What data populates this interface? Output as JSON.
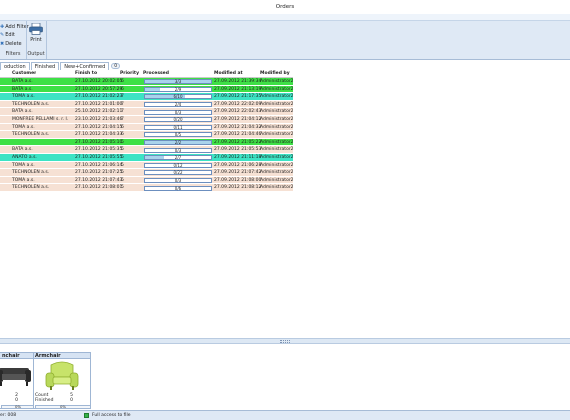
{
  "window": {
    "title": "Orders"
  },
  "ribbon": {
    "add_filter": "Add Filter",
    "edit": "Edit",
    "delete": "Delete",
    "filters_label": "Filters",
    "print": "Print",
    "output_label": "Output"
  },
  "tabs": [
    {
      "label": "oduction"
    },
    {
      "label": "Finished"
    },
    {
      "label": "New+Confirmed"
    }
  ],
  "tab_badge": "0",
  "grid": {
    "columns": [
      "Customer",
      "Finish to",
      "Priority",
      "Processed",
      "Modified at",
      "Modified by"
    ],
    "rows": [
      {
        "customer": "BATA a.s.",
        "finish": "27.10.2012 20:02:05",
        "priority": "6",
        "processed": "3/3",
        "progress": 1.0,
        "modified_at": "27.09.2012 21:39:34",
        "modified_by": "Administrator2",
        "bg": "#3ee046"
      },
      {
        "customer": "BATA a.s.",
        "finish": "27.10.2012 20:57:29",
        "priority": "6",
        "processed": "2/9",
        "progress": 0.22,
        "modified_at": "27.09.2012 21:13:19",
        "modified_by": "Administrator2",
        "bg": "#3ee046"
      },
      {
        "customer": "TOMA a.s.",
        "finish": "27.10.2012 21:02:23",
        "priority": "7",
        "processed": "6/10",
        "progress": 0.6,
        "modified_at": "27.09.2012 21:17:35",
        "modified_by": "Administrator2",
        "bg": "#3de3c4"
      },
      {
        "customer": "TECHNOLEN a.s.",
        "finish": "27.10.2012 21:01:00",
        "priority": "7",
        "processed": "2/4",
        "progress": 0,
        "modified_at": "27.09.2012 22:02:09",
        "modified_by": "Administrator2",
        "bg": "#f6e1d4"
      },
      {
        "customer": "BATA a.s.",
        "finish": "25.10.2012 21:02:11",
        "priority": "7",
        "processed": "0/3",
        "progress": 0,
        "modified_at": "27.09.2012 22:02:43",
        "modified_by": "Administrator2",
        "bg": "#f6e1d4"
      },
      {
        "customer": "MONFREE PELLAMI s. r. l.",
        "finish": "23.10.2012 21:03:46",
        "priority": "7",
        "processed": "0/20",
        "progress": 0,
        "modified_at": "27.09.2012 21:04:12",
        "modified_by": "Administrator2",
        "bg": "#f6e1d4"
      },
      {
        "customer": "TOMA a.s.",
        "finish": "27.10.2012 21:04:15",
        "priority": "6",
        "processed": "0/11",
        "progress": 0,
        "modified_at": "27.09.2012 21:04:32",
        "modified_by": "Administrator2",
        "bg": "#f6e1d4"
      },
      {
        "customer": "TECHNOLEN a.s.",
        "finish": "27.10.2012 21:04:33",
        "priority": "6",
        "processed": "0/5",
        "progress": 0,
        "modified_at": "27.09.2012 21:04:46",
        "modified_by": "Administrator2",
        "bg": "#f6e1d4"
      },
      {
        "customer": "",
        "finish": "27.10.2012 21:05:10",
        "priority": "5",
        "processed": "2/2",
        "progress": 1.0,
        "modified_at": "27.09.2012 21:05:22",
        "modified_by": "Administrator2",
        "bg": "#3ee046"
      },
      {
        "customer": "BATA a.s.",
        "finish": "27.10.2012 21:05:35",
        "priority": "5",
        "processed": "0/3",
        "progress": 0,
        "modified_at": "27.09.2012 21:05:53",
        "modified_by": "Administrator2",
        "bg": "#f6e1d4"
      },
      {
        "customer": "ANATO a.s.",
        "finish": "27.10.2012 21:05:55",
        "priority": "5",
        "processed": "2/7",
        "progress": 0.29,
        "modified_at": "27.09.2012 21:11:18",
        "modified_by": "Administrator2",
        "bg": "#3de3c4"
      },
      {
        "customer": "TOMA a.s.",
        "finish": "27.10.2012 21:06:14",
        "priority": "5",
        "processed": "0/12",
        "progress": 0,
        "modified_at": "27.09.2012 21:06:28",
        "modified_by": "Administrator2",
        "bg": "#f6e1d4"
      },
      {
        "customer": "TECHNOLEN a.s.",
        "finish": "27.10.2012 21:07:25",
        "priority": "5",
        "processed": "0/22",
        "progress": 0,
        "modified_at": "27.09.2012 21:07:42",
        "modified_by": "Administrator2",
        "bg": "#f6e1d4"
      },
      {
        "customer": "TOMA a.s.",
        "finish": "27.10.2012 21:07:43",
        "priority": "5",
        "processed": "0/3",
        "progress": 0,
        "modified_at": "27.09.2012 21:08:00",
        "modified_by": "Administrator2",
        "bg": "#f6e1d4"
      },
      {
        "customer": "TECHNOLEN a.s.",
        "finish": "27.10.2012 21:08:01",
        "priority": "5",
        "processed": "0/6",
        "progress": 0,
        "modified_at": "27.09.2012 21:08:12",
        "modified_by": "Administrator2",
        "bg": "#f6e1d4"
      }
    ]
  },
  "cards": [
    {
      "title": "nchair",
      "icon": "sofa-icon",
      "count_label": "",
      "count": "2",
      "finished_label": "",
      "finished": "0",
      "percent": "0%"
    },
    {
      "title": "Armchair",
      "icon": "armchair-icon",
      "count_label": "Count",
      "count": "5",
      "finished_label": "Finished",
      "finished": "0",
      "percent": "0%"
    }
  ],
  "status_bar": {
    "left_text": "er: 008",
    "access_text": "Full access to file"
  },
  "colors": {
    "done": "#3ee046",
    "in_progress": "#3de3c4",
    "pending": "#f6e1d4",
    "ribbon": "#dfe9f5"
  }
}
